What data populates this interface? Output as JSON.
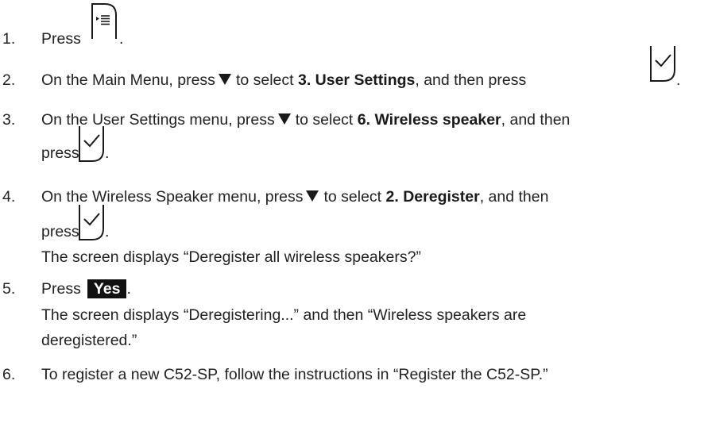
{
  "steps": [
    {
      "num": "1.",
      "text": "Press",
      "end": "."
    },
    {
      "num": "2.",
      "pre": "On the Main Menu, press",
      "mid": "to select",
      "bold": "3. User Settings",
      "post": ", and then press",
      "end": "."
    },
    {
      "num": "3.",
      "pre": "On the User Settings menu, press",
      "mid": "to select",
      "bold": "6. Wireless speaker",
      "post": ", and then",
      "line2": "press",
      "end": "."
    },
    {
      "num": "4.",
      "pre": "On the Wireless Speaker menu, press",
      "mid": "to select",
      "bold": "2. Deregister",
      "post": ", and then",
      "line2": "press",
      "end": ".",
      "result": "The screen displays “Deregister all wireless speakers?”"
    },
    {
      "num": "5.",
      "text": "Press",
      "button": "Yes",
      "end": ".",
      "result1": "The screen displays “Deregistering...” and then “Wireless speakers are",
      "result2": "deregistered.”"
    },
    {
      "num": "6.",
      "text": "To register a new C52-SP, follow the instructions in “Register the C52-SP.”"
    }
  ],
  "icons": {
    "menu_key": "menu-key-icon",
    "ok_key": "ok-check-key-icon",
    "down_arrow": "down-triangle-icon"
  }
}
